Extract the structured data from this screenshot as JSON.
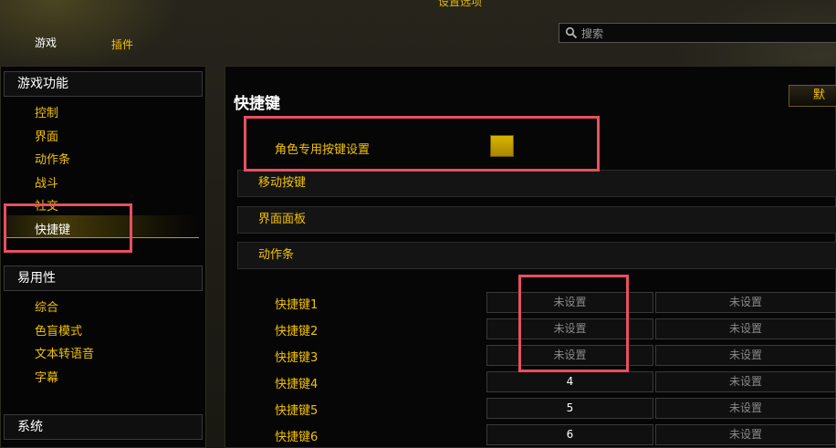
{
  "window": {
    "title": "设置选项"
  },
  "top_tabs": {
    "game": "游戏",
    "addons": "插件"
  },
  "search": {
    "placeholder": "搜索"
  },
  "sidebar": {
    "game_features": {
      "header": "游戏功能",
      "items": [
        "控制",
        "界面",
        "动作条",
        "战斗",
        "社交",
        "快捷键"
      ],
      "selected": "快捷键"
    },
    "accessibility": {
      "header": "易用性",
      "items": [
        "综合",
        "色盲模式",
        "文本转语音",
        "字幕"
      ]
    },
    "system": {
      "header": "系统"
    }
  },
  "main": {
    "title": "快捷键",
    "default_button": "默",
    "character_specific": {
      "label": "角色专用按键设置",
      "checked": true
    },
    "sections": [
      "移动按键",
      "界面面板",
      "动作条"
    ],
    "bindings": [
      {
        "label": "快捷键1",
        "key1": "未设置",
        "key2": "未设置"
      },
      {
        "label": "快捷键2",
        "key1": "未设置",
        "key2": "未设置"
      },
      {
        "label": "快捷键3",
        "key1": "未设置",
        "key2": "未设置"
      },
      {
        "label": "快捷键4",
        "key1": "4",
        "key2": "未设置"
      },
      {
        "label": "快捷键5",
        "key1": "5",
        "key2": "未设置"
      },
      {
        "label": "快捷键6",
        "key1": "6",
        "key2": "未设置"
      }
    ]
  },
  "colors": {
    "accent": "#f2c200",
    "highlight": "#e8505f",
    "checkbox": "#d8b400"
  }
}
